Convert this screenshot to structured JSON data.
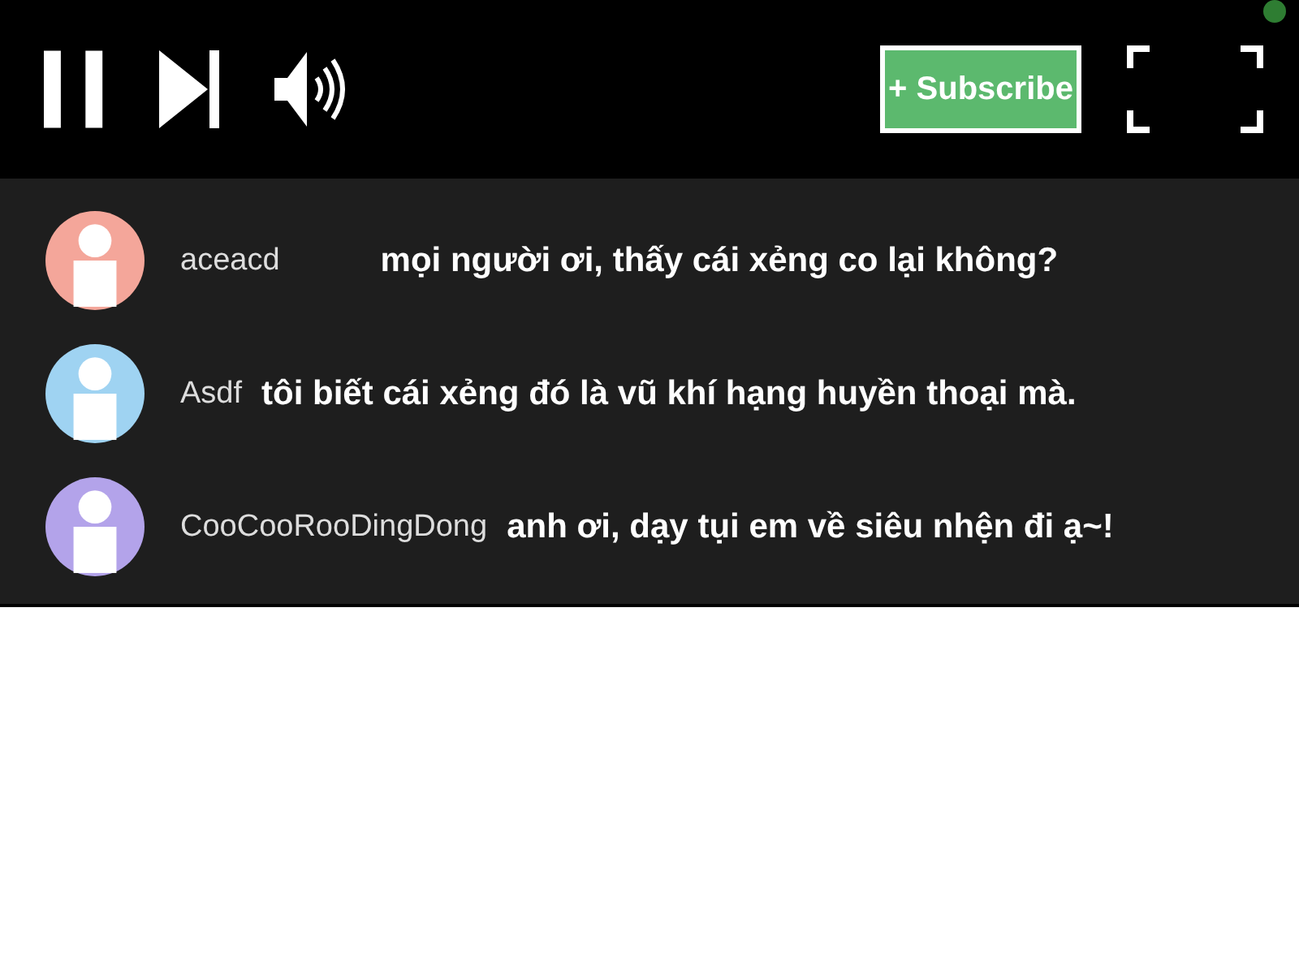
{
  "player": {
    "subscribe_label": "+ Subscribe"
  },
  "comments": [
    {
      "username": "aceacd",
      "message": "mọi người ơi, thấy cái xẻng co lại không?",
      "color": "#f4a69a"
    },
    {
      "username": "Asdf",
      "message": "tôi biết cái xẻng đó là vũ khí hạng huyền thoại mà.",
      "color": "#9fd3f2"
    },
    {
      "username": "CooCooRooDingDong",
      "message": "anh ơi, dạy tụi em về siêu nhện đi ạ~!",
      "color": "#b3a3ea"
    }
  ]
}
